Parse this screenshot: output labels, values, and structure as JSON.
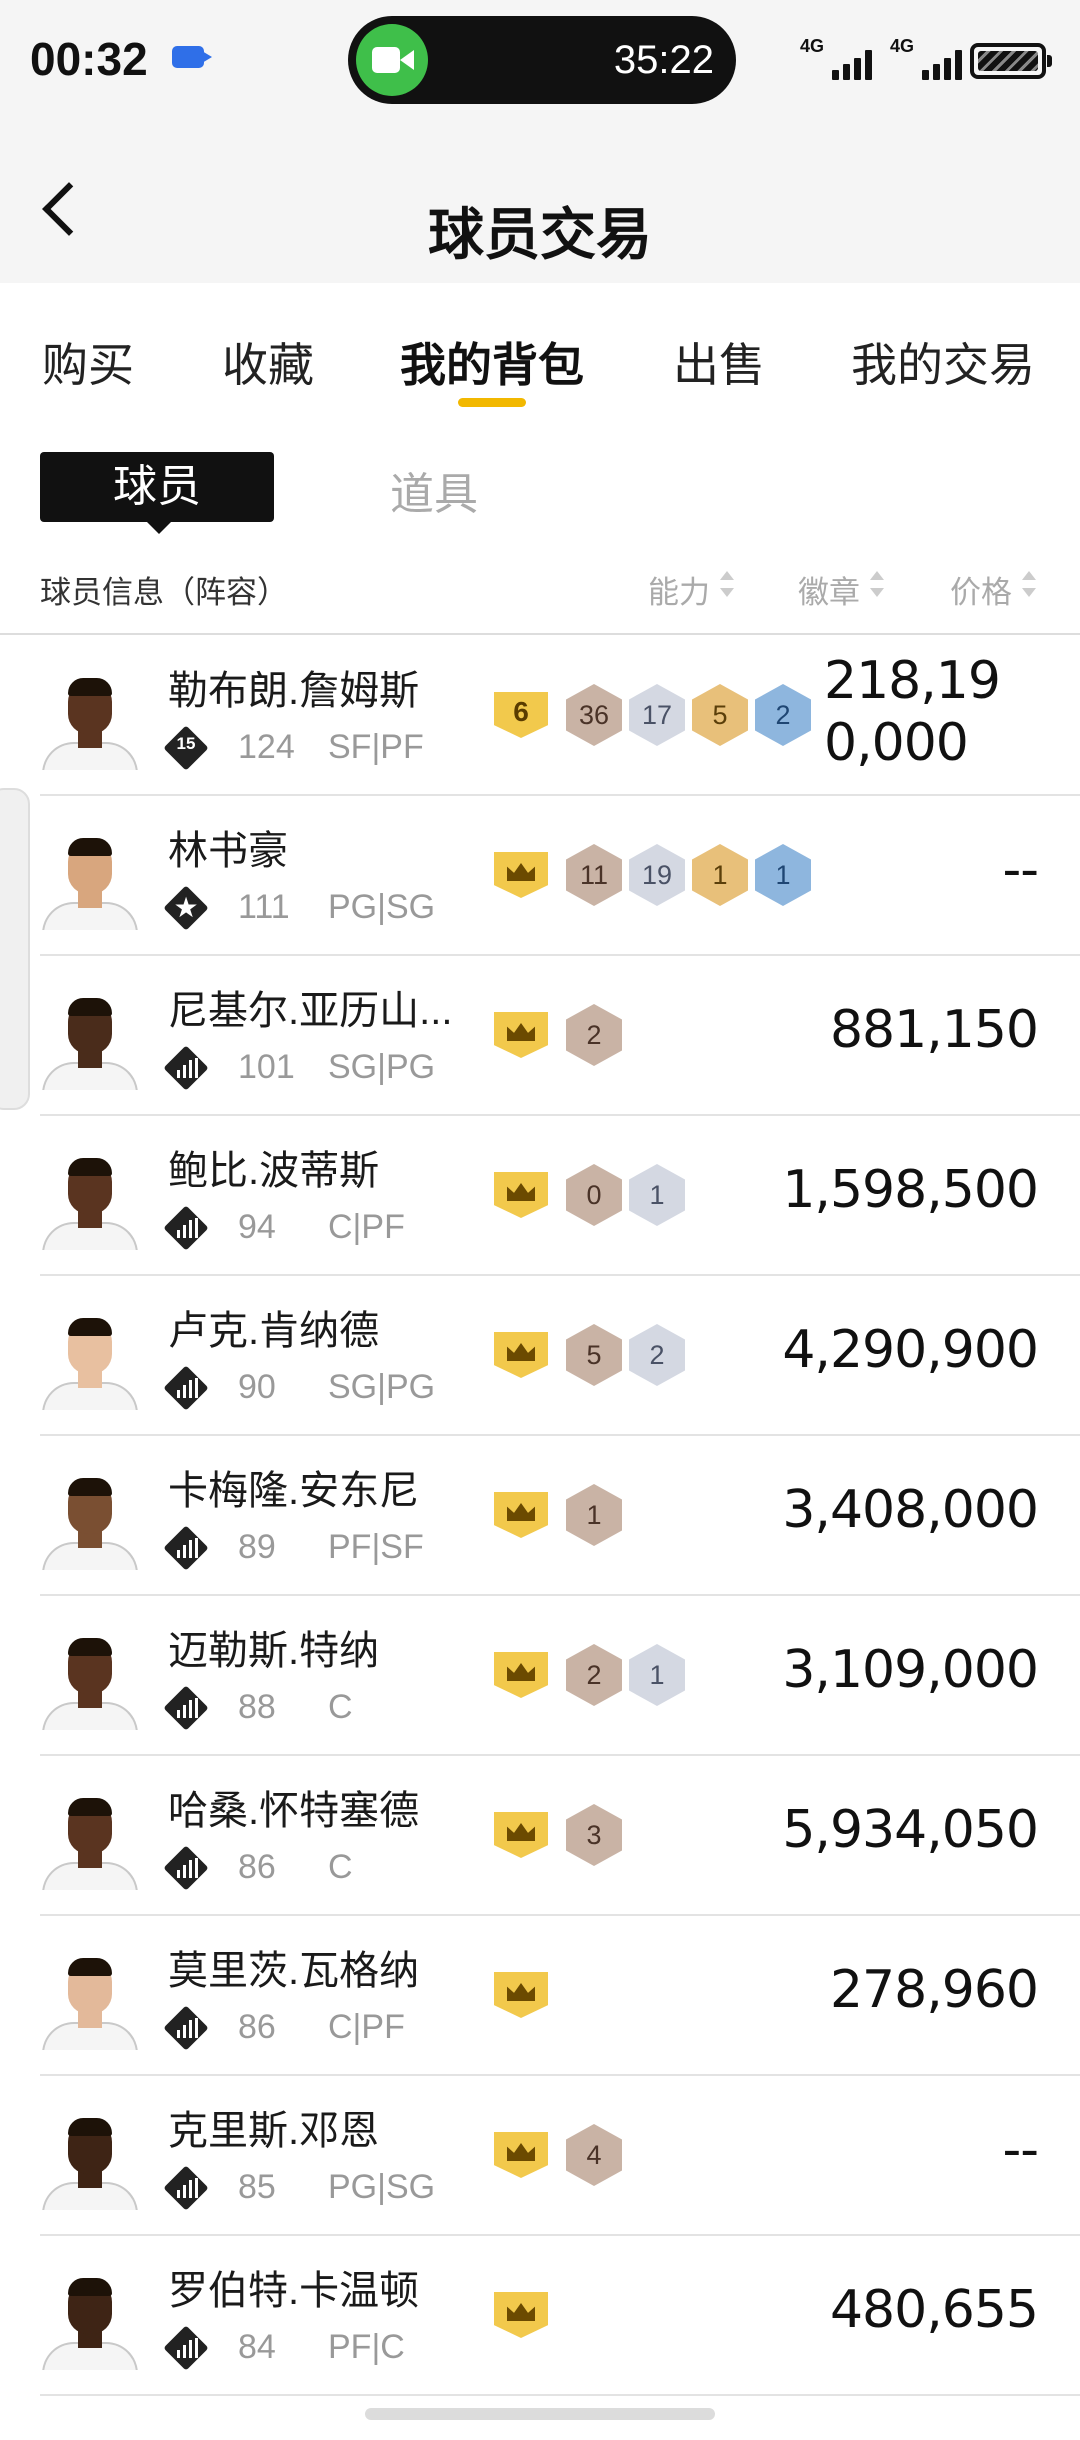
{
  "status_bar": {
    "time": "00:32",
    "call_timer": "35:22",
    "signal_1": "4G",
    "signal_2": "4G",
    "icons": [
      "video-icon",
      "facetime-icon",
      "signal-icon",
      "battery-icon"
    ]
  },
  "header": {
    "title": "球员交易",
    "back_icon": "chevron-left-icon"
  },
  "tabs": [
    {
      "label": "购买",
      "active": false
    },
    {
      "label": "收藏",
      "active": false
    },
    {
      "label": "我的背包",
      "active": true
    },
    {
      "label": "出售",
      "active": false
    },
    {
      "label": "我的交易",
      "active": false
    }
  ],
  "subtabs": [
    {
      "label": "球员",
      "active": true
    },
    {
      "label": "道具",
      "active": false
    }
  ],
  "list_header": {
    "info": "球员信息（阵容）",
    "ability": "能力",
    "badges": "徽章",
    "price": "价格"
  },
  "colors": {
    "accent": "#f2b800",
    "crown": "#f2c94c",
    "badge_bronze": "#c9b3a5",
    "badge_silver": "#d4d8e2",
    "badge_gold": "#e8c07a",
    "badge_hof": "#8eb6de"
  },
  "players": [
    {
      "name": "勒布朗.詹姆斯",
      "tier": "15",
      "rating": "124",
      "position": "SF|PF",
      "level": "6",
      "badges": [
        "36",
        "17",
        "5",
        "2"
      ],
      "price": "218,190,000"
    },
    {
      "name": "林书豪",
      "tier": "star",
      "rating": "111",
      "position": "PG|SG",
      "level": "crown",
      "badges": [
        "11",
        "19",
        "1",
        "1"
      ],
      "price": "--"
    },
    {
      "name": "尼基尔.亚历山...",
      "tier": "bars",
      "rating": "101",
      "position": "SG|PG",
      "level": "crown",
      "badges": [
        "2"
      ],
      "price": "881,150"
    },
    {
      "name": "鲍比.波蒂斯",
      "tier": "bars",
      "rating": "94",
      "position": "C|PF",
      "level": "crown",
      "badges": [
        "0",
        "1"
      ],
      "price": "1,598,500"
    },
    {
      "name": "卢克.肯纳德",
      "tier": "bars",
      "rating": "90",
      "position": "SG|PG",
      "level": "crown",
      "badges": [
        "5",
        "2"
      ],
      "price": "4,290,900"
    },
    {
      "name": "卡梅隆.安东尼",
      "tier": "bars",
      "rating": "89",
      "position": "PF|SF",
      "level": "crown",
      "badges": [
        "1"
      ],
      "price": "3,408,000"
    },
    {
      "name": "迈勒斯.特纳",
      "tier": "bars",
      "rating": "88",
      "position": "C",
      "level": "crown",
      "badges": [
        "2",
        "1"
      ],
      "price": "3,109,000"
    },
    {
      "name": "哈桑.怀特塞德",
      "tier": "bars",
      "rating": "86",
      "position": "C",
      "level": "crown",
      "badges": [
        "3"
      ],
      "price": "5,934,050"
    },
    {
      "name": "莫里茨.瓦格纳",
      "tier": "bars",
      "rating": "86",
      "position": "C|PF",
      "level": "crown",
      "badges": [],
      "price": "278,960"
    },
    {
      "name": "克里斯.邓恩",
      "tier": "bars",
      "rating": "85",
      "position": "PG|SG",
      "level": "crown",
      "badges": [
        "4"
      ],
      "price": "--"
    },
    {
      "name": "罗伯特.卡温顿",
      "tier": "bars",
      "rating": "84",
      "position": "PF|C",
      "level": "crown",
      "badges": [],
      "price": "480,655"
    }
  ]
}
